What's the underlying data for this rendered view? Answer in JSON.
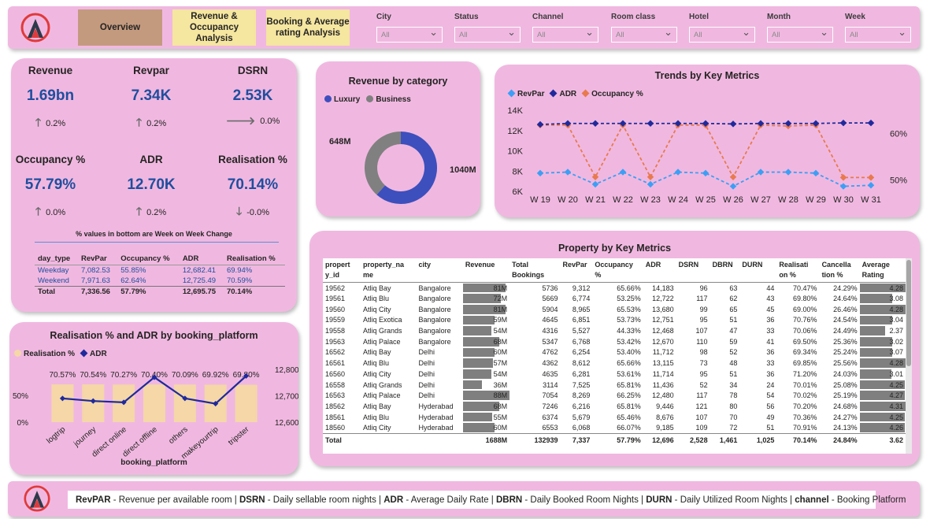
{
  "nav": {
    "overview": "Overview",
    "revenue_occupancy": "Revenue & Occupancy Analysis",
    "booking_rating": "Booking & Average rating Analysis"
  },
  "filters": [
    {
      "label": "City",
      "value": "All"
    },
    {
      "label": "Status",
      "value": "All"
    },
    {
      "label": "Channel",
      "value": "All"
    },
    {
      "label": "Room class",
      "value": "All"
    },
    {
      "label": "Hotel",
      "value": "All"
    },
    {
      "label": "Month",
      "value": "All"
    },
    {
      "label": "Week",
      "value": "All"
    }
  ],
  "kpis": {
    "revenue": {
      "title": "Revenue",
      "value": "1.69bn",
      "delta": "0.2%",
      "arrow": "up"
    },
    "revpar": {
      "title": "Revpar",
      "value": "7.34K",
      "delta": "0.2%",
      "arrow": "up"
    },
    "dsrn": {
      "title": "DSRN",
      "value": "2.53K",
      "delta": "0.0%",
      "arrow": "right"
    },
    "occupancy": {
      "title": "Occupancy %",
      "value": "57.79%",
      "delta": "0.0%",
      "arrow": "up"
    },
    "adr": {
      "title": "ADR",
      "value": "12.70K",
      "delta": "0.2%",
      "arrow": "up"
    },
    "realisation": {
      "title": "Realisation %",
      "value": "70.14%",
      "delta": "-0.0%",
      "arrow": "down"
    },
    "note": "% values in bottom are Week on Week Change"
  },
  "day_type_table": {
    "headers": [
      "day_type",
      "RevPar",
      "Occupancy %",
      "ADR",
      "Realisation %"
    ],
    "rows": [
      [
        "Weekday",
        "7,082.53",
        "55.85%",
        "12,682.41",
        "69.94%"
      ],
      [
        "Weekend",
        "7,971.63",
        "62.64%",
        "12,725.49",
        "70.59%"
      ]
    ],
    "total": [
      "Total",
      "7,336.56",
      "57.79%",
      "12,695.75",
      "70.14%"
    ]
  },
  "revenue_by_category": {
    "title": "Revenue by category",
    "legend": [
      "Luxury",
      "Business"
    ],
    "colors": {
      "Luxury": "#3d4fbd",
      "Business": "#808080"
    },
    "chart_data": {
      "type": "pie",
      "categories": [
        "Luxury",
        "Business"
      ],
      "values": [
        1040,
        648
      ],
      "labels": [
        "1040M",
        "648M"
      ]
    }
  },
  "trends": {
    "title": "Trends by Key Metrics",
    "legend": [
      "RevPar",
      "ADR",
      "Occupancy %"
    ],
    "colors": {
      "RevPar": "#3d9ef5",
      "ADR": "#1f2a9c",
      "Occupancy %": "#e87a4e"
    },
    "chart_data": {
      "type": "line",
      "x": [
        "W 19",
        "W 20",
        "W 21",
        "W 22",
        "W 23",
        "W 24",
        "W 25",
        "W 26",
        "W 27",
        "W 28",
        "W 29",
        "W 30",
        "W 31"
      ],
      "series": [
        {
          "name": "RevPar",
          "axis": "left",
          "values": [
            7800,
            7900,
            6700,
            7900,
            6700,
            7900,
            7800,
            6500,
            7900,
            7900,
            7800,
            6500,
            6600
          ]
        },
        {
          "name": "ADR",
          "axis": "left",
          "values": [
            12600,
            12700,
            12700,
            12700,
            12700,
            12700,
            12700,
            12650,
            12700,
            12700,
            12700,
            12750,
            12750
          ]
        },
        {
          "name": "Occupancy %",
          "axis": "right",
          "values": [
            61.8,
            61.8,
            50.6,
            61.8,
            50.6,
            61.8,
            61.8,
            50.6,
            61.8,
            61.6,
            61.8,
            50.5,
            50.5
          ]
        }
      ],
      "yticks_left": [
        "14K",
        "12K",
        "10K",
        "8K",
        "6K"
      ],
      "ylim_left": [
        6000,
        14000
      ],
      "yticks_right": [
        "60%",
        "50%"
      ],
      "ylim_right": [
        47.5,
        65
      ]
    }
  },
  "realisation_adr": {
    "title": "Realisation % and ADR by booking_platform",
    "legend": [
      "Realisation %",
      "ADR"
    ],
    "colors": {
      "Realisation %": "#f5d7a8",
      "ADR": "#1f2a9c"
    },
    "xlabel": "booking_platform",
    "chart_data": {
      "type": "bar",
      "categories": [
        "logtrip",
        "journey",
        "direct online",
        "direct offline",
        "others",
        "makeyourtrip",
        "tripster"
      ],
      "series": [
        {
          "name": "Realisation %",
          "axis": "left",
          "values": [
            70.57,
            70.54,
            70.27,
            70.4,
            70.09,
            69.92,
            69.8
          ],
          "labels": [
            "70.57%",
            "70.54%",
            "70.27%",
            "70.40%",
            "70.09%",
            "69.92%",
            "69.80%"
          ]
        },
        {
          "name": "ADR",
          "axis": "right",
          "type": "line",
          "values": [
            12690,
            12680,
            12675,
            12770,
            12690,
            12670,
            12775
          ]
        }
      ],
      "yticks_left": [
        "50%",
        "0%"
      ],
      "ylim_left": [
        0,
        100
      ],
      "yticks_right": [
        "12,800",
        "12,700",
        "12,600"
      ],
      "ylim_right": [
        12600,
        12800
      ]
    }
  },
  "property_table": {
    "title": "Property by Key Metrics",
    "headers": [
      "property_id",
      "property_name",
      "city",
      "Revenue",
      "Total Bookings",
      "RevPar",
      "Occupancy %",
      "ADR",
      "DSRN",
      "DBRN",
      "DURN",
      "Realisation %",
      "Cancellation %",
      "Average Rating"
    ],
    "header_display": [
      "propert y_id",
      "property_na me",
      "city",
      "Revenue",
      "Total Bookings",
      "RevPar",
      "Occupancy %",
      "ADR",
      "DSRN",
      "DBRN",
      "DURN",
      "Realisati on %",
      "Cancella tion %",
      "Average Rating"
    ],
    "rows": [
      [
        "19562",
        "Atliq Bay",
        "Bangalore",
        "81M",
        "5736",
        "9,312",
        "65.66%",
        "14,183",
        "96",
        "63",
        "44",
        "70.47%",
        "24.29%",
        "4.28"
      ],
      [
        "19561",
        "Atliq Blu",
        "Bangalore",
        "72M",
        "5669",
        "6,774",
        "53.25%",
        "12,722",
        "117",
        "62",
        "43",
        "69.80%",
        "24.64%",
        "3.08"
      ],
      [
        "19560",
        "Atliq City",
        "Bangalore",
        "81M",
        "5904",
        "8,965",
        "65.53%",
        "13,680",
        "99",
        "65",
        "45",
        "69.00%",
        "26.46%",
        "4.28"
      ],
      [
        "19559",
        "Atliq Exotica",
        "Bangalore",
        "59M",
        "4645",
        "6,851",
        "53.73%",
        "12,751",
        "95",
        "51",
        "36",
        "70.76%",
        "24.54%",
        "3.04"
      ],
      [
        "19558",
        "Atliq Grands",
        "Bangalore",
        "54M",
        "4316",
        "5,527",
        "44.33%",
        "12,468",
        "107",
        "47",
        "33",
        "70.06%",
        "24.49%",
        "2.37"
      ],
      [
        "19563",
        "Atliq Palace",
        "Bangalore",
        "68M",
        "5347",
        "6,768",
        "53.42%",
        "12,670",
        "110",
        "59",
        "41",
        "69.50%",
        "25.36%",
        "3.02"
      ],
      [
        "16562",
        "Atliq Bay",
        "Delhi",
        "60M",
        "4762",
        "6,254",
        "53.40%",
        "11,712",
        "98",
        "52",
        "36",
        "69.34%",
        "25.24%",
        "3.07"
      ],
      [
        "16561",
        "Atliq Blu",
        "Delhi",
        "57M",
        "4362",
        "8,612",
        "65.66%",
        "13,115",
        "73",
        "48",
        "33",
        "69.85%",
        "25.56%",
        "4.28"
      ],
      [
        "16560",
        "Atliq City",
        "Delhi",
        "54M",
        "4635",
        "6,281",
        "53.61%",
        "11,714",
        "95",
        "51",
        "36",
        "71.20%",
        "24.03%",
        "3.01"
      ],
      [
        "16558",
        "Atliq Grands",
        "Delhi",
        "36M",
        "3114",
        "7,525",
        "65.81%",
        "11,436",
        "52",
        "34",
        "24",
        "70.01%",
        "25.08%",
        "4.25"
      ],
      [
        "16563",
        "Atliq Palace",
        "Delhi",
        "88M",
        "7054",
        "8,269",
        "66.25%",
        "12,480",
        "117",
        "78",
        "54",
        "70.02%",
        "25.19%",
        "4.27"
      ],
      [
        "18562",
        "Atliq Bay",
        "Hyderabad",
        "68M",
        "7246",
        "6,216",
        "65.81%",
        "9,446",
        "121",
        "80",
        "56",
        "70.20%",
        "24.68%",
        "4.31"
      ],
      [
        "18561",
        "Atliq Blu",
        "Hyderabad",
        "55M",
        "6374",
        "5,679",
        "65.46%",
        "8,676",
        "107",
        "70",
        "49",
        "70.36%",
        "24.27%",
        "4.25"
      ],
      [
        "18560",
        "Atliq City",
        "Hyderabad",
        "60M",
        "6553",
        "6,068",
        "66.07%",
        "9,185",
        "109",
        "72",
        "51",
        "70.91%",
        "24.13%",
        "4.26"
      ]
    ],
    "total": [
      "Total",
      "",
      "",
      "1688M",
      "132939",
      "7,337",
      "57.79%",
      "12,696",
      "2,528",
      "1,461",
      "1,025",
      "70.14%",
      "24.84%",
      "3.62"
    ]
  },
  "footer": {
    "segments": [
      {
        "key": "RevPAR",
        "desc": " - Revenue per available room | "
      },
      {
        "key": "DSRN",
        "desc": " - Daily sellable room nights | "
      },
      {
        "key": "ADR",
        "desc": " - Average Daily Rate | "
      },
      {
        "key": "DBRN",
        "desc": " - Daily Booked Room Nights | "
      },
      {
        "key": "DURN",
        "desc": " - Daily Utilized Room Nights | "
      },
      {
        "key": "channel",
        "desc": " - Booking Platform"
      }
    ]
  },
  "colors": {
    "panel": "#f0b8e0",
    "overview_active": "#c49a7f",
    "nav_button": "#f5e6a0",
    "accent_blue": "#1f4e9e",
    "logo_red": "#e03a3a",
    "logo_dark": "#2d3a4a"
  }
}
